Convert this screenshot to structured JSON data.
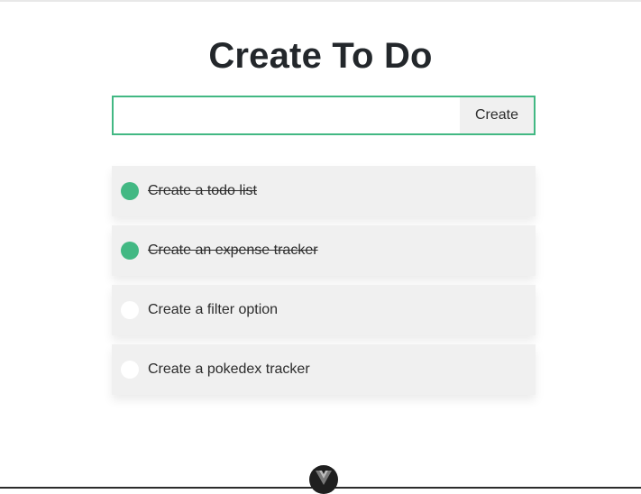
{
  "header": {
    "title": "Create To Do"
  },
  "form": {
    "input_value": "",
    "input_placeholder": "",
    "create_label": "Create"
  },
  "todos": [
    {
      "text": "Create a todo list",
      "done": true
    },
    {
      "text": "Create an expense tracker",
      "done": true
    },
    {
      "text": "Create a filter option",
      "done": false
    },
    {
      "text": "Create a pokedex tracker",
      "done": false
    }
  ],
  "footer": {
    "badge_icon": "vue-logo-icon"
  },
  "colors": {
    "accent": "#42b883",
    "item_background": "#f0f0f0",
    "badge_background": "#1f1f1f"
  }
}
